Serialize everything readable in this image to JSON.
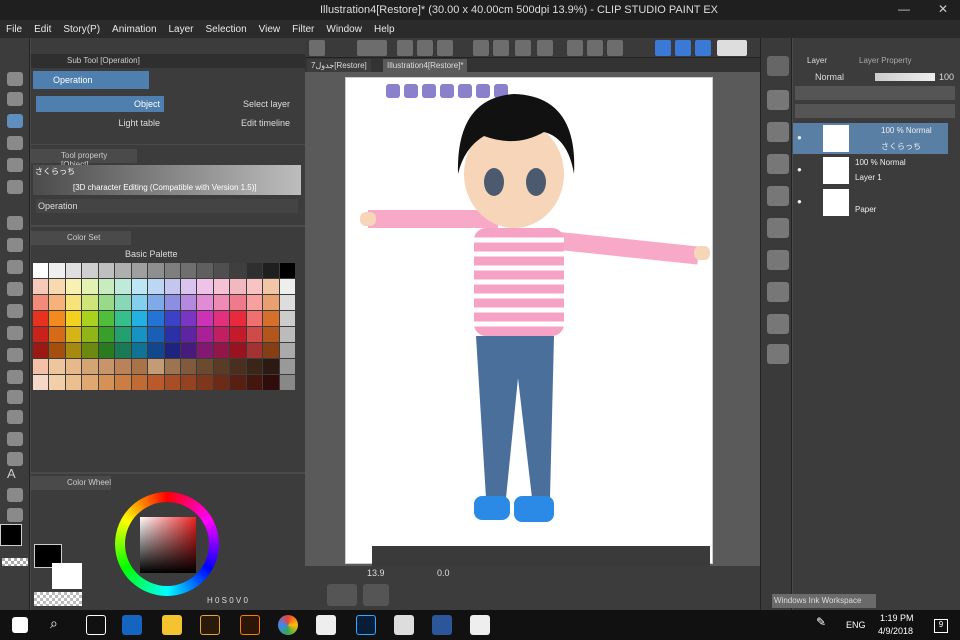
{
  "window": {
    "title": "Illustration4[Restore]* (30.00 x 40.00cm 500dpi 13.9%)  -  CLIP STUDIO PAINT EX"
  },
  "menu": [
    "File",
    "Edit",
    "Story(P)",
    "Animation",
    "Layer",
    "Selection",
    "View",
    "Filter",
    "Window",
    "Help"
  ],
  "subtool": {
    "title": "Sub Tool [Operation]",
    "operation": "Operation",
    "object": "Object",
    "light_table": "Light table",
    "select_layer": "Select layer",
    "edit_timeline": "Edit timeline"
  },
  "toolprop": {
    "title": "Tool property [Object]",
    "name": "さくらっち",
    "desc": "[3D character Editing (Compatible with Version 1.5)]",
    "operation": "Operation"
  },
  "colorset": {
    "title": "Color Set",
    "palette": "Basic Palette",
    "colors": [
      "#ffffff",
      "#efefef",
      "#dfdfdf",
      "#cfcfcf",
      "#bfbfbf",
      "#afafaf",
      "#9f9f9f",
      "#8f8f8f",
      "#7f7f7f",
      "#6f6f6f",
      "#5f5f5f",
      "#4f4f4f",
      "#3f3f3f",
      "#2f2f2f",
      "#1f1f1f",
      "#000000",
      "#f7c9b8",
      "#f8d9b0",
      "#f9f0b4",
      "#e3f2b3",
      "#c9ecbe",
      "#bfe9d9",
      "#bde6f4",
      "#bcd6f3",
      "#c5c6f0",
      "#dac3ef",
      "#efc3e8",
      "#f5c1d4",
      "#f2b8c0",
      "#f7c3c3",
      "#f1c6a6",
      "#eeeeee",
      "#f18b7a",
      "#f6b27a",
      "#f6e37a",
      "#cfe57a",
      "#98d98a",
      "#88d7b7",
      "#82d0ee",
      "#80a9e8",
      "#8c8fe1",
      "#b48ae0",
      "#e08bd3",
      "#ef8ab4",
      "#ef7a8b",
      "#f6a0a0",
      "#e8a070",
      "#dddddd",
      "#e9321e",
      "#f28a1e",
      "#f3d11e",
      "#a9d21e",
      "#4fbe3b",
      "#35bf8a",
      "#23b0e3",
      "#2673d6",
      "#3b42c8",
      "#7b35c5",
      "#cc31b6",
      "#e3307c",
      "#e82a3c",
      "#f07070",
      "#d66e2c",
      "#cccccc",
      "#c8221a",
      "#d66a16",
      "#d6b316",
      "#8fb516",
      "#38a02a",
      "#239f70",
      "#1693c3",
      "#1a5eb6",
      "#2a30a8",
      "#5f24a4",
      "#aa2197",
      "#c11f61",
      "#c51a2a",
      "#d04a4a",
      "#b4561c",
      "#bbbbbb",
      "#9a1912",
      "#a44f10",
      "#a68a10",
      "#6c8a10",
      "#2a7a20",
      "#197a55",
      "#107294",
      "#13478b",
      "#1f2380",
      "#471b7c",
      "#821872",
      "#931649",
      "#96131f",
      "#a53232",
      "#863f14",
      "#aaaaaa",
      "#f4c0a8",
      "#eec69c",
      "#e8b88b",
      "#d4a574",
      "#c8946a",
      "#b98258",
      "#a87348",
      "#c49b77",
      "#9d7452",
      "#7f5a3c",
      "#6b4a30",
      "#5a3c26",
      "#4a2f1e",
      "#3b2418",
      "#2c1a12",
      "#999999",
      "#f5d8c8",
      "#f2cfa8",
      "#ebc08e",
      "#e0a870",
      "#d69256",
      "#cc7d44",
      "#c06a34",
      "#b85a2a",
      "#a84e24",
      "#94421f",
      "#80361a",
      "#6c2b16",
      "#582012",
      "#44160e",
      "#300d0a",
      "#888888"
    ]
  },
  "colorwheel": {
    "title": "Color Wheel",
    "values": "H 0  S 0  V 0"
  },
  "tabs": {
    "tab1": "جدول7[Restore]",
    "tab2": "Illustration4[Restore]*"
  },
  "canvas": {
    "zoom": "13.9",
    "angle": "0.0"
  },
  "layers": {
    "panel_title": "Layer",
    "panel_title2": "Layer Property",
    "blend": "Normal",
    "opacity": "100",
    "items": [
      {
        "mode": "100 % Normal",
        "name": "さくらっち"
      },
      {
        "mode": "100 % Normal",
        "name": "Layer 1"
      },
      {
        "mode": "",
        "name": "Paper"
      }
    ]
  },
  "taskbar": {
    "lang": "ENG",
    "time": "1:19 PM",
    "date": "4/9/2018",
    "notif": "9",
    "ink": "Windows Ink Workspace"
  }
}
